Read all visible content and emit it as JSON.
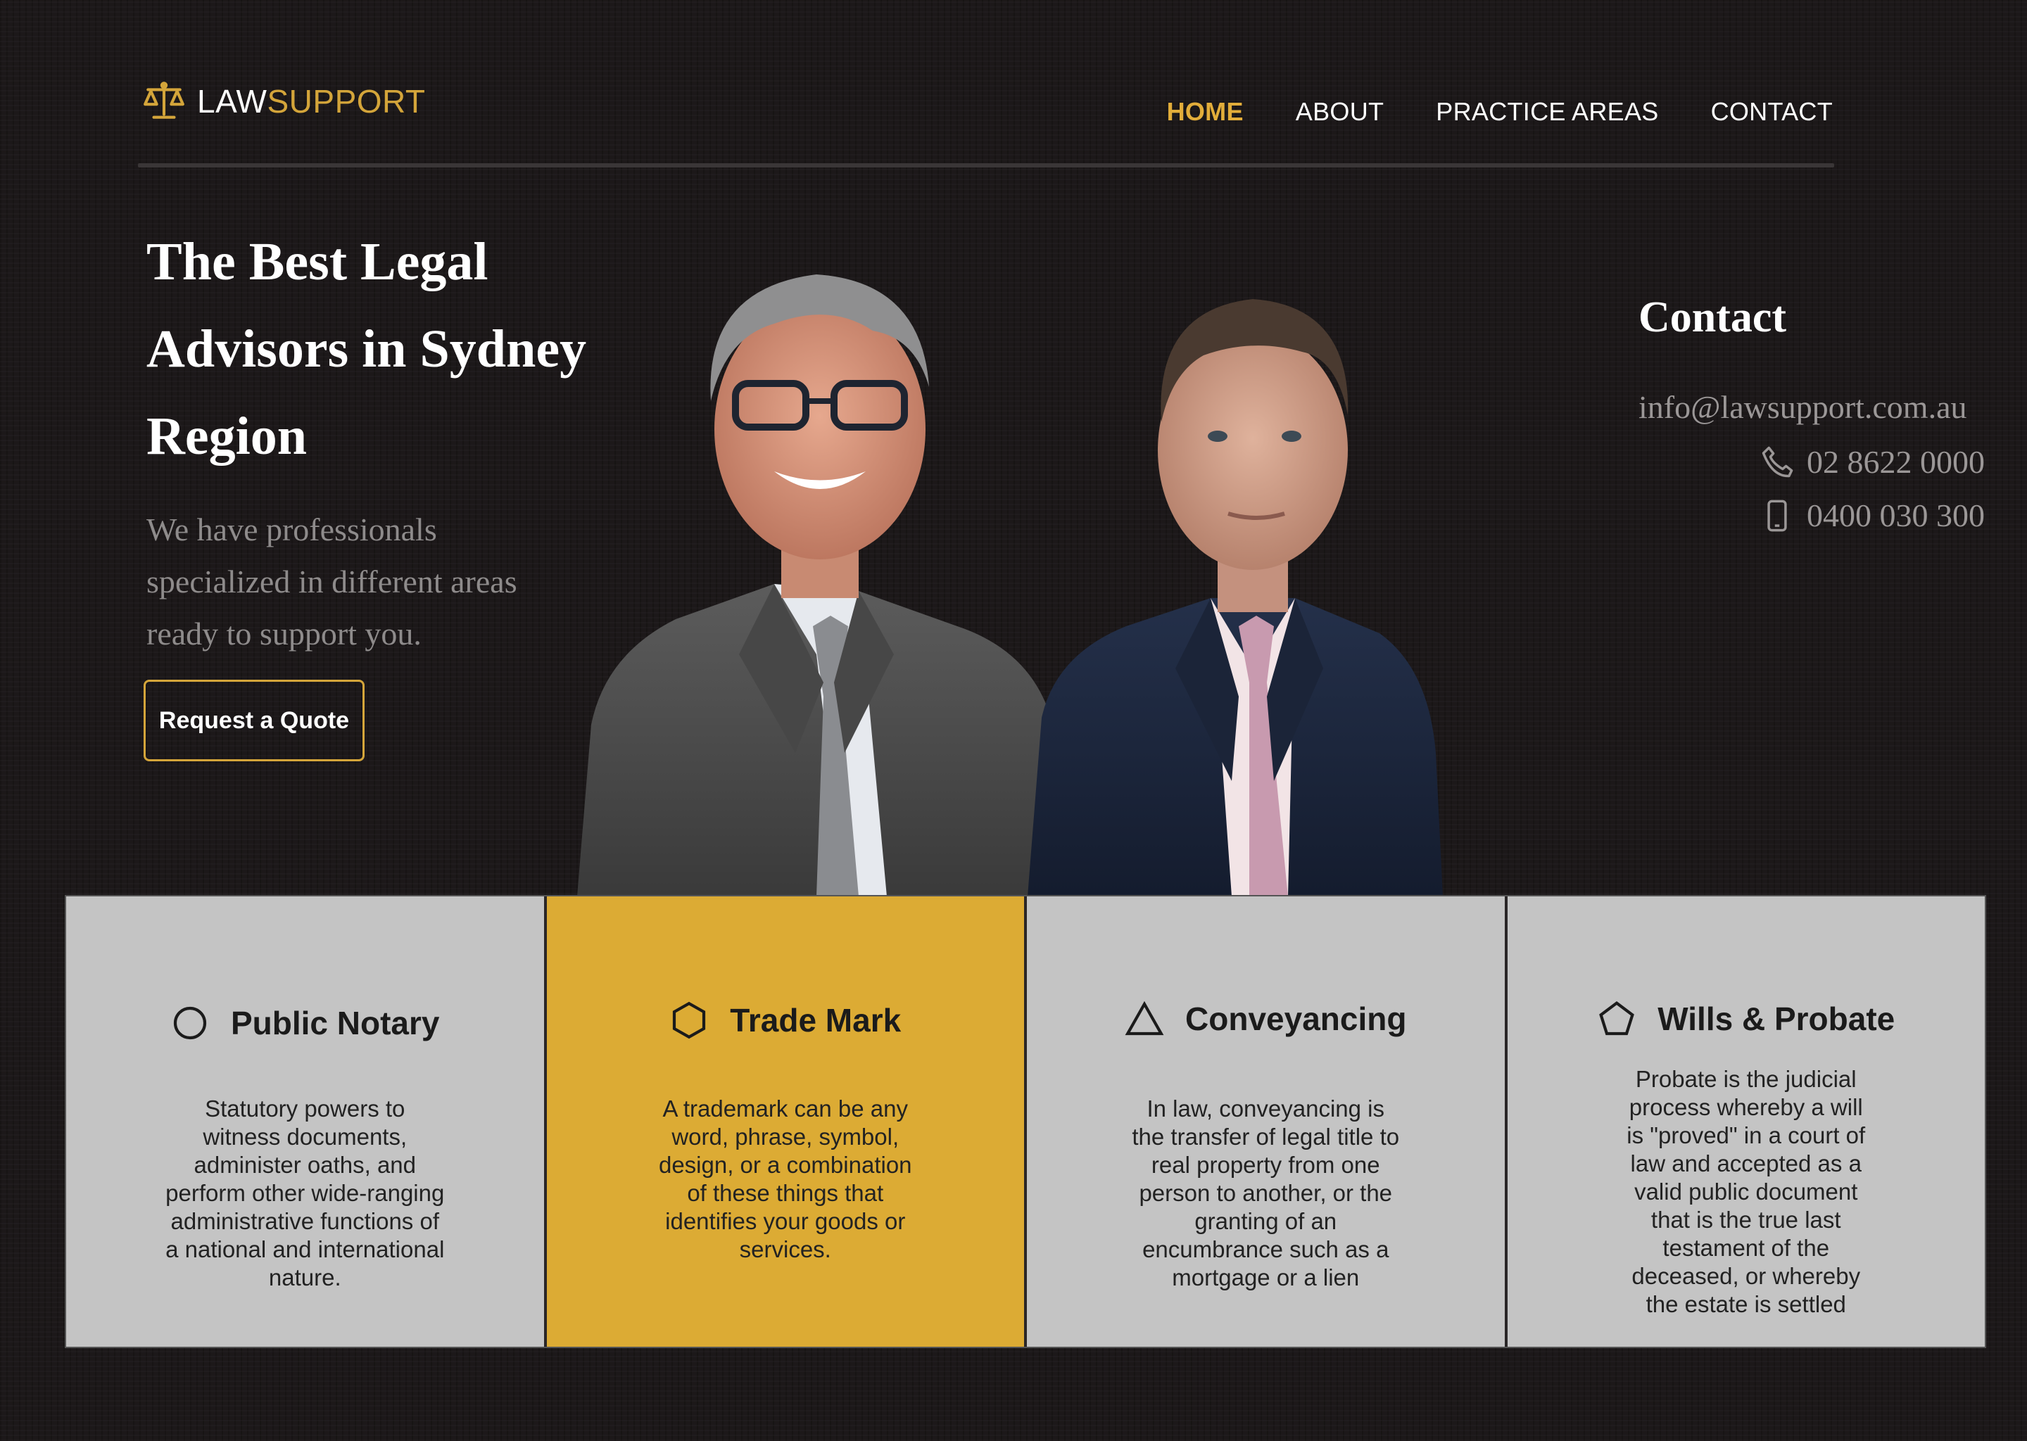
{
  "brand": {
    "name_part1": "LAW",
    "name_part2": "SUPPORT",
    "icon": "scales-icon"
  },
  "nav": {
    "items": [
      {
        "label": "HOME",
        "active": true
      },
      {
        "label": "ABOUT",
        "active": false
      },
      {
        "label": "PRACTICE AREAS",
        "active": false
      },
      {
        "label": "CONTACT",
        "active": false
      }
    ]
  },
  "hero": {
    "title": "The Best Legal Advisors in Sydney Region",
    "subtitle": "We have professionals specialized in different areas ready to support you.",
    "cta_label": "Request a Quote"
  },
  "contact": {
    "title": "Contact",
    "email": "info@lawsupport.com.au",
    "phone": "02 8622 0000",
    "mobile": "0400 030 300",
    "phone_icon": "phone-icon",
    "mobile_icon": "mobile-icon"
  },
  "services": [
    {
      "title": "Public Notary",
      "icon": "circle-icon",
      "highlight": false,
      "text": "Statutory powers to witness documents, administer oaths, and perform other wide-ranging administrative functions of a national and international nature."
    },
    {
      "title": "Trade Mark",
      "icon": "hexagon-icon",
      "highlight": true,
      "text": "A trademark can be any word, phrase, symbol, design, or a combination of these things that identifies your goods or services."
    },
    {
      "title": "Conveyancing",
      "icon": "triangle-icon",
      "highlight": false,
      "text": "In law, conveyancing is the transfer of legal title to real property from one person to another, or the granting of an encumbrance such as a mortgage or a lien"
    },
    {
      "title": "Wills & Probate",
      "icon": "pentagon-icon",
      "highlight": false,
      "text": "Probate is the judicial process whereby a will is \"proved\" in a court of law and accepted as a valid public document that is the true last testament of the deceased, or whereby the estate is settled"
    }
  ],
  "colors": {
    "accent": "#dcab34",
    "background": "#1c1819",
    "card": "#c4c4c4"
  }
}
